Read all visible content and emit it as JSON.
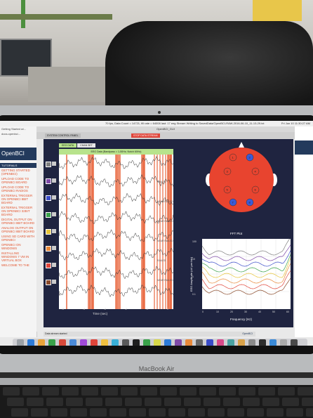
{
  "photo": {
    "device_label": "MacBook Air"
  },
  "menubar": {
    "window_title": "70 fps, Data Count = 14721, fill rate = 64008 last: 17 eeg Stream Writing to SavedData/OpenBCI-RAW-2016-06-10_11-13-29.txt",
    "clock": "Fri Jun 10 11:30:27 AM"
  },
  "browser_sidebar": {
    "tabs": [
      "Getting Started w/...",
      "docs.openbci..."
    ],
    "logo": "OpenBCI",
    "section": "TUTORIALS",
    "nav_items": [
      "GETTING STARTED (OPENBCI)",
      "UPLOAD CODE TO OPENBCI BOARD",
      "UPLOAD CODE TO OPENBCI RADIOS",
      "EXTERNAL TRIGGER ON OPENBCI 8BIT BOARD",
      "EXTERNAL TRIGGER ON OPENBCI 32BIT BOARD",
      "DIGITAL OUTPUT ON OPENBCI 8BIT BOARD",
      "ANALOG OUTPUT ON OPENBCI 8BIT BOARD",
      "USING SD CARD WITH OPENBCI",
      "OPENBCI ON WINDOWS",
      "INSTALLING WINDOWS 7 VM IN VIRTUAL BOX",
      "WELCOME TO THE"
    ]
  },
  "app": {
    "title": "OpenBCI_GUI",
    "toolbar": {
      "system_control": "SYSTEM CONTROL PANEL",
      "stop": "STOP DATA STREAM"
    },
    "eeg": {
      "tabs": [
        "EEG DATA",
        "CHAN SET"
      ],
      "plot_title": "EEG Data (Bandpass = 1-50Hz; Notch 60Hz)",
      "xlabel": "Time (sec)",
      "xticks": [
        "-5",
        "-4",
        "-3",
        "-2",
        "-1",
        "0"
      ],
      "railed": [
        "RAILED",
        "NEAR RAILED",
        "NEAR RAILED",
        "NEAR RAILED",
        "RAILED",
        "NEAR RAILED"
      ]
    },
    "head": {
      "electrodes": [
        "1",
        "2",
        "3",
        "4",
        "5",
        "6",
        "7",
        "8"
      ]
    },
    "fft": {
      "title": "FFT Plot",
      "ylabel": "EEG Amplitude (uV per bin)",
      "xlabel": "Frequency (Hz)",
      "yticks": [
        "100",
        "10",
        "1",
        "0.1"
      ],
      "xticks": [
        "0",
        "10",
        "20",
        "30",
        "40",
        "50",
        "60"
      ]
    },
    "status": "Data stream started",
    "brand": "OpenBCI"
  },
  "colors": {
    "head_red": "#e8442f",
    "channel_colors": [
      "#7f7f7f",
      "#7f4aa8",
      "#3a4cc8",
      "#3aa24a",
      "#e8c63a",
      "#e8893a",
      "#e0453a",
      "#8a4a2a"
    ],
    "accent_green": "#b8e38c",
    "panel_navy": "#1f2440"
  }
}
